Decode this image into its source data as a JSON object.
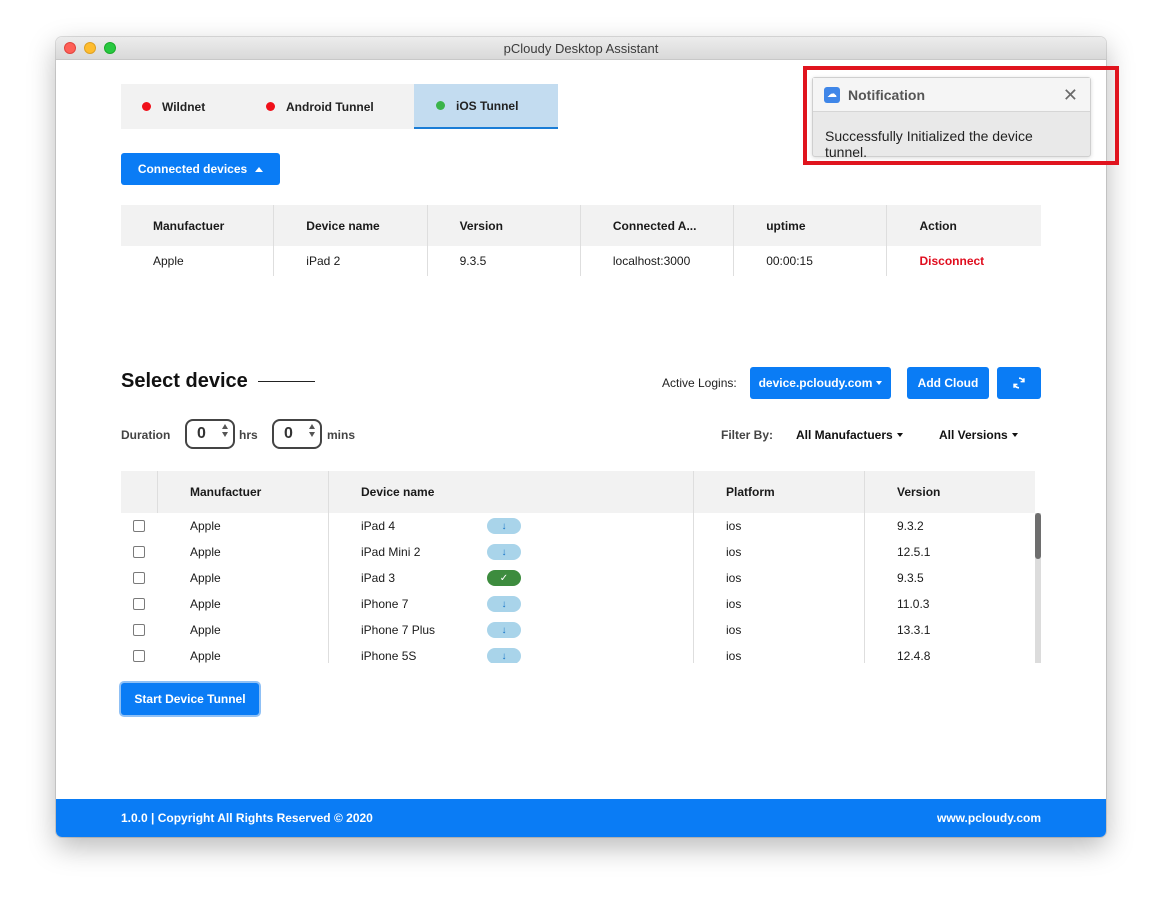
{
  "window": {
    "title": "pCloudy Desktop Assistant"
  },
  "tabs": [
    {
      "label": "Wildnet",
      "status_color": "#f0101a"
    },
    {
      "label": "Android Tunnel",
      "status_color": "#f0101a"
    },
    {
      "label": "iOS Tunnel",
      "status_color": "#3bb44a",
      "active": true
    }
  ],
  "connected": {
    "button_label": "Connected devices",
    "headers": [
      "Manufactuer",
      "Device name",
      "Version",
      "Connected A...",
      "uptime",
      "Action"
    ],
    "rows": [
      {
        "manufacturer": "Apple",
        "device": "iPad 2",
        "version": "9.3.5",
        "address": "localhost:3000",
        "uptime": "00:00:15",
        "action": "Disconnect"
      }
    ]
  },
  "select": {
    "title": "Select device",
    "active_logins_label": "Active Logins:",
    "login_value": "device.pcloudy.com",
    "add_cloud_label": "Add Cloud",
    "duration_label": "Duration",
    "hours_value": "0",
    "hours_unit": "hrs",
    "minutes_value": "0",
    "minutes_unit": "mins",
    "filter_label": "Filter By:",
    "filter_manufacturers": "All Manufactuers",
    "filter_versions": "All Versions"
  },
  "devices": {
    "headers": [
      "Manufactuer",
      "Device name",
      "Platform",
      "Version"
    ],
    "rows": [
      {
        "manufacturer": "Apple",
        "device": "iPad 4",
        "status": "download",
        "platform": "ios",
        "version": "9.3.2"
      },
      {
        "manufacturer": "Apple",
        "device": "iPad Mini 2",
        "status": "download",
        "platform": "ios",
        "version": "12.5.1"
      },
      {
        "manufacturer": "Apple",
        "device": "iPad 3",
        "status": "ready",
        "platform": "ios",
        "version": "9.3.5"
      },
      {
        "manufacturer": "Apple",
        "device": "iPhone 7",
        "status": "download",
        "platform": "ios",
        "version": "11.0.3"
      },
      {
        "manufacturer": "Apple",
        "device": "iPhone 7 Plus",
        "status": "download",
        "platform": "ios",
        "version": "13.3.1"
      },
      {
        "manufacturer": "Apple",
        "device": "iPhone 5S",
        "status": "download",
        "platform": "ios",
        "version": "12.4.8"
      }
    ],
    "start_button_label": "Start Device Tunnel"
  },
  "footer": {
    "copyright": "1.0.0 | Copyright All Rights Reserved © 2020",
    "website": "www.pcloudy.com"
  },
  "notification": {
    "title": "Notification",
    "message": "Successfully Initialized the device tunnel.",
    "highlight_color": "#e0141e"
  },
  "colors": {
    "accent": "#0a7cf5",
    "danger": "#e00d1e",
    "success": "#3d8c3e"
  }
}
